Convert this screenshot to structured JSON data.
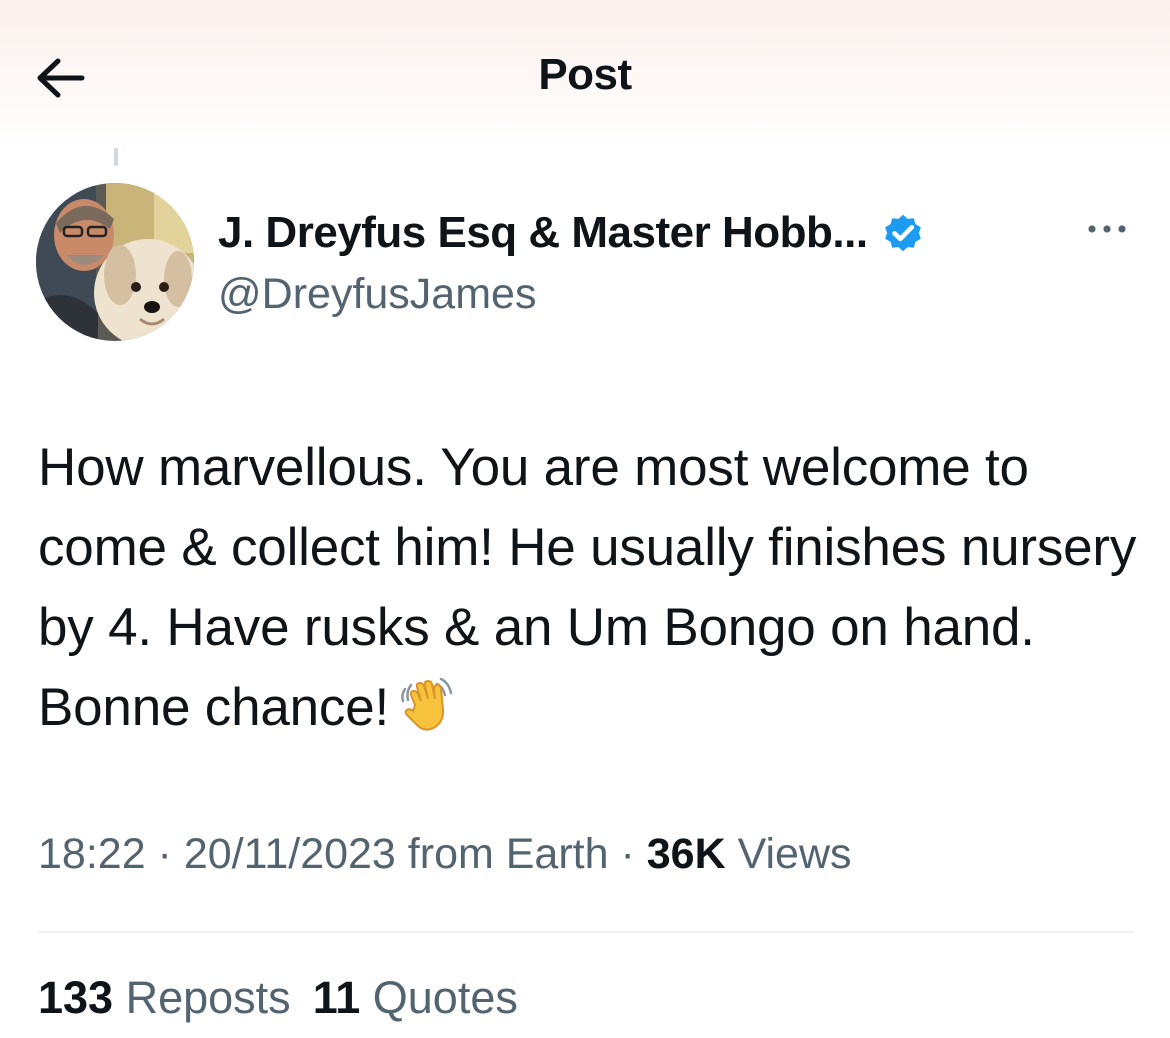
{
  "header": {
    "title": "Post",
    "back_icon": "arrow-left-icon"
  },
  "author": {
    "display_name": "J. Dreyfus Esq & Master Hobb...",
    "handle": "@DreyfusJames",
    "verified_icon": "verified-badge-icon",
    "verified_color": "#1d9bf0",
    "avatar_icon": "avatar-photo",
    "more_icon": "more-horizontal-icon"
  },
  "tweet": {
    "text": "How marvellous. You are most welcome to come & collect him! He usually finishes nursery by 4. Have rusks & an Um Bongo on hand. Bonne chance!",
    "emoji": "waving-hand-emoji"
  },
  "meta": {
    "time": "18:22",
    "sep1": " · ",
    "date": "20/11/2023",
    "source": " from Earth",
    "sep2": " · ",
    "views_count": "36K",
    "views_label": " Views"
  },
  "stats": {
    "reposts_count": "133",
    "reposts_label": " Reposts",
    "quotes_count": "11",
    "quotes_label": " Quotes"
  },
  "colors": {
    "text_primary": "#0f1419",
    "text_secondary": "#536471",
    "accent": "#1d9bf0"
  }
}
